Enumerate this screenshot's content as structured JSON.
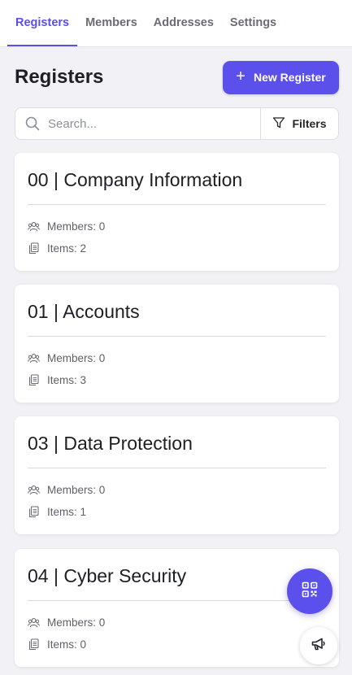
{
  "tabs": [
    {
      "label": "Registers",
      "active": true
    },
    {
      "label": "Members",
      "active": false
    },
    {
      "label": "Addresses",
      "active": false
    },
    {
      "label": "Settings",
      "active": false
    }
  ],
  "header": {
    "title": "Registers",
    "new_button_label": "New Register"
  },
  "search": {
    "placeholder": "Search...",
    "value": "",
    "filters_label": "Filters"
  },
  "registers": [
    {
      "title": "00 | Company Information",
      "members": "Members: 0",
      "items": "Items: 2"
    },
    {
      "title": "01 | Accounts",
      "members": "Members: 0",
      "items": "Items: 3"
    },
    {
      "title": "03 | Data Protection",
      "members": "Members: 0",
      "items": "Items: 1"
    },
    {
      "title": "04 | Cyber Security",
      "members": "Members: 0",
      "items": "Items: 0"
    }
  ],
  "icons": {
    "search": "search-icon",
    "filter": "filter-icon",
    "plus": "plus-icon",
    "members": "users-icon",
    "items": "files-icon",
    "qr": "qr-code-icon",
    "feedback": "megaphone-icon"
  },
  "colors": {
    "accent": "#5b50ec",
    "background": "#f2f2f6",
    "card": "#ffffff"
  }
}
